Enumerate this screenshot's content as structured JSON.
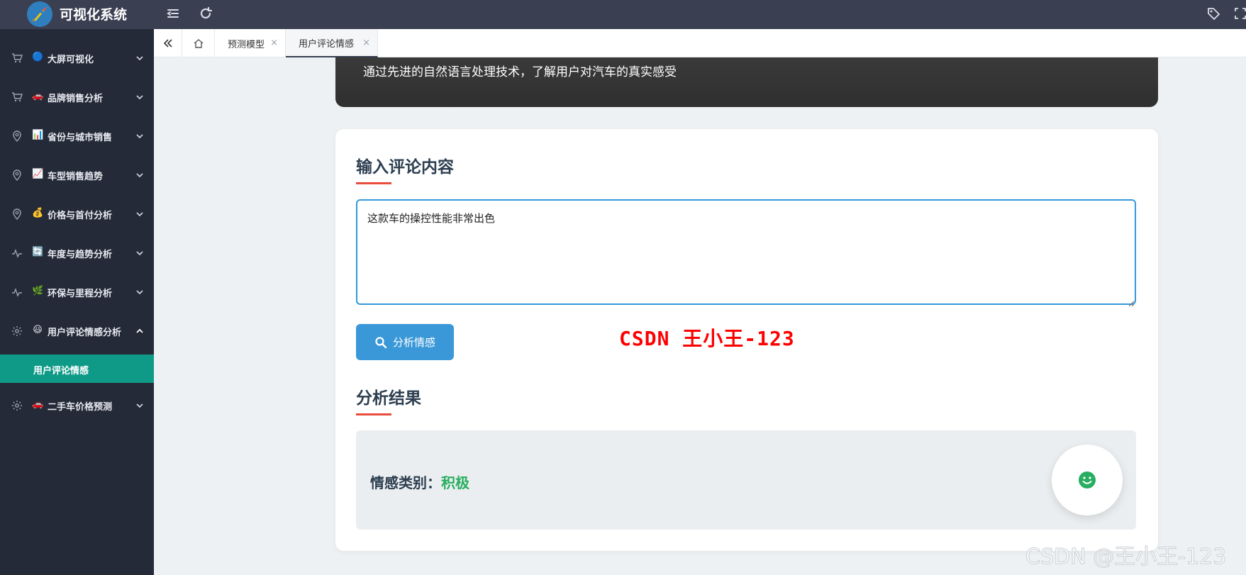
{
  "app": {
    "title": "可视化系统"
  },
  "sidebar": {
    "items": [
      {
        "label": "大屏可视化",
        "emoji": "🔵",
        "icon": "cart-icon",
        "chevron": "down"
      },
      {
        "label": "品牌销售分析",
        "emoji": "🚗",
        "icon": "cart-icon",
        "chevron": "down"
      },
      {
        "label": "省份与城市销售",
        "emoji": "📊",
        "icon": "location-icon",
        "chevron": "down"
      },
      {
        "label": "车型销售趋势",
        "emoji": "📈",
        "icon": "location-icon",
        "chevron": "down"
      },
      {
        "label": "价格与首付分析",
        "emoji": "💰",
        "icon": "location-icon",
        "chevron": "down"
      },
      {
        "label": "年度与趋势分析",
        "emoji": "🔄",
        "icon": "pulse-icon",
        "chevron": "down"
      },
      {
        "label": "环保与里程分析",
        "emoji": "🌿",
        "icon": "pulse-icon",
        "chevron": "down"
      },
      {
        "label": "用户评论情感分析",
        "emoji": "😃",
        "icon": "gear-icon",
        "chevron": "up"
      },
      {
        "label": "二手车价格预测",
        "emoji": "🚗",
        "icon": "gear-icon",
        "chevron": "down"
      }
    ],
    "active_sub": "用户评论情感"
  },
  "tabs": [
    {
      "label": "预测模型",
      "close": "×"
    },
    {
      "label": "用户评论情感",
      "close": "×"
    }
  ],
  "banner": {
    "text": "通过先进的自然语言处理技术，了解用户对汽车的真实感受"
  },
  "input_section": {
    "title": "输入评论内容",
    "value": "这款车的操控性能非常出色"
  },
  "analyze_button": {
    "label": "分析情感",
    "icon": "search-icon"
  },
  "watermark_red": "CSDN 王小王-123",
  "result_section": {
    "title": "分析结果",
    "label": "情感类别：",
    "value": "积极",
    "icon": "smile-icon"
  },
  "watermark_gray": "CSDN @王小王-123",
  "colors": {
    "topbar": "#3a3f51",
    "sidebar": "#252a38",
    "active_sub": "#0f9a88",
    "accent_blue": "#3a98d8",
    "positive": "#27ae60",
    "title_underline": "#e74c3c"
  }
}
